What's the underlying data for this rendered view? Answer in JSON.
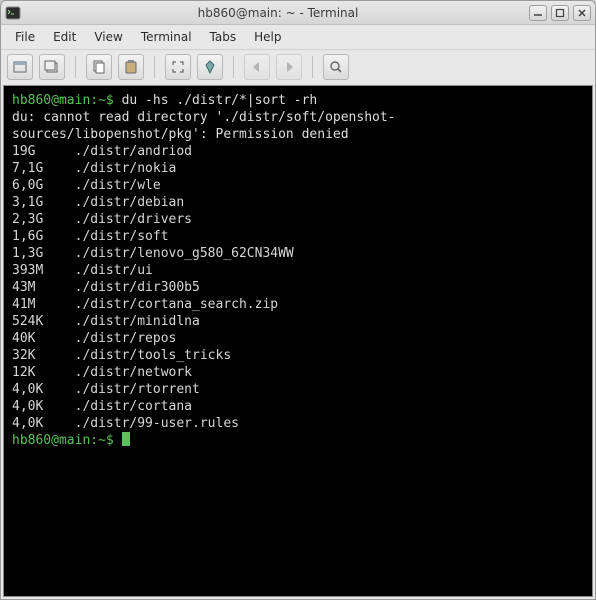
{
  "window": {
    "title": "hb860@main: ~ - Terminal"
  },
  "menubar": {
    "file": "File",
    "edit": "Edit",
    "view": "View",
    "terminal": "Terminal",
    "tabs": "Tabs",
    "help": "Help"
  },
  "prompt": {
    "user_host": "hb860@main",
    "path": "~",
    "symbol": "$"
  },
  "command": "du -hs ./distr/*|sort -rh",
  "error_text": "du: cannot read directory './distr/soft/openshot-sources/libopenshot/pkg': Permission denied",
  "entries": [
    {
      "size": "19G",
      "path": "./distr/andriod"
    },
    {
      "size": "7,1G",
      "path": "./distr/nokia"
    },
    {
      "size": "6,0G",
      "path": "./distr/wle"
    },
    {
      "size": "3,1G",
      "path": "./distr/debian"
    },
    {
      "size": "2,3G",
      "path": "./distr/drivers"
    },
    {
      "size": "1,6G",
      "path": "./distr/soft"
    },
    {
      "size": "1,3G",
      "path": "./distr/lenovo_g580_62CN34WW"
    },
    {
      "size": "393M",
      "path": "./distr/ui"
    },
    {
      "size": "43M",
      "path": "./distr/dir300b5"
    },
    {
      "size": "41M",
      "path": "./distr/cortana_search.zip"
    },
    {
      "size": "524K",
      "path": "./distr/minidlna"
    },
    {
      "size": "40K",
      "path": "./distr/repos"
    },
    {
      "size": "32K",
      "path": "./distr/tools_tricks"
    },
    {
      "size": "12K",
      "path": "./distr/network"
    },
    {
      "size": "4,0K",
      "path": "./distr/rtorrent"
    },
    {
      "size": "4,0K",
      "path": "./distr/cortana"
    },
    {
      "size": "4,0K",
      "path": "./distr/99-user.rules"
    }
  ]
}
